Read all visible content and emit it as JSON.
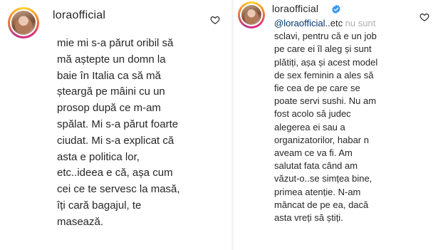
{
  "left_comment": {
    "username": "loraofficial",
    "text": "mie mi s-a părut oribil să\nmă aștepte un domn la\nbaie în Italia ca să mă\nșteargă pe mâini cu un\nprosop după ce m-am\nspălat. Mi s-a părut foarte\nciudat. Mi s-a explicat că\nasta e politica lor,\netc..ideea e că, așa cum\ncei ce te servesc la masă,\nîți cară bagajul, te\nmasează."
  },
  "right_comment": {
    "username": "loraofficial",
    "mention": "@loraofficial",
    "first_line_rest": "..etc ",
    "first_line_faded": "nu sunt",
    "text": "sclavi, pentru că e un job\npe care ei îl aleg și sunt\nplătiți, așa și acest model\nde sex feminin a ales să\nfie cea de pe care se\npoate servi sushi. Nu am\nfost acolo să judec\nalegerea ei sau a\norganizatorilor, habar n\naveam ce va fi. Am\nsalutat fata când am\nvăzut-o..se simțea bine,\nprimea atenție. N-am\nmâncat de pe ea, dacă\nasta vreți să știți."
  },
  "icons": {
    "verified": "verified-badge-icon",
    "like": "heart-icon"
  },
  "colors": {
    "text": "#262626",
    "mention": "#003569",
    "verified": "#3897f0"
  }
}
